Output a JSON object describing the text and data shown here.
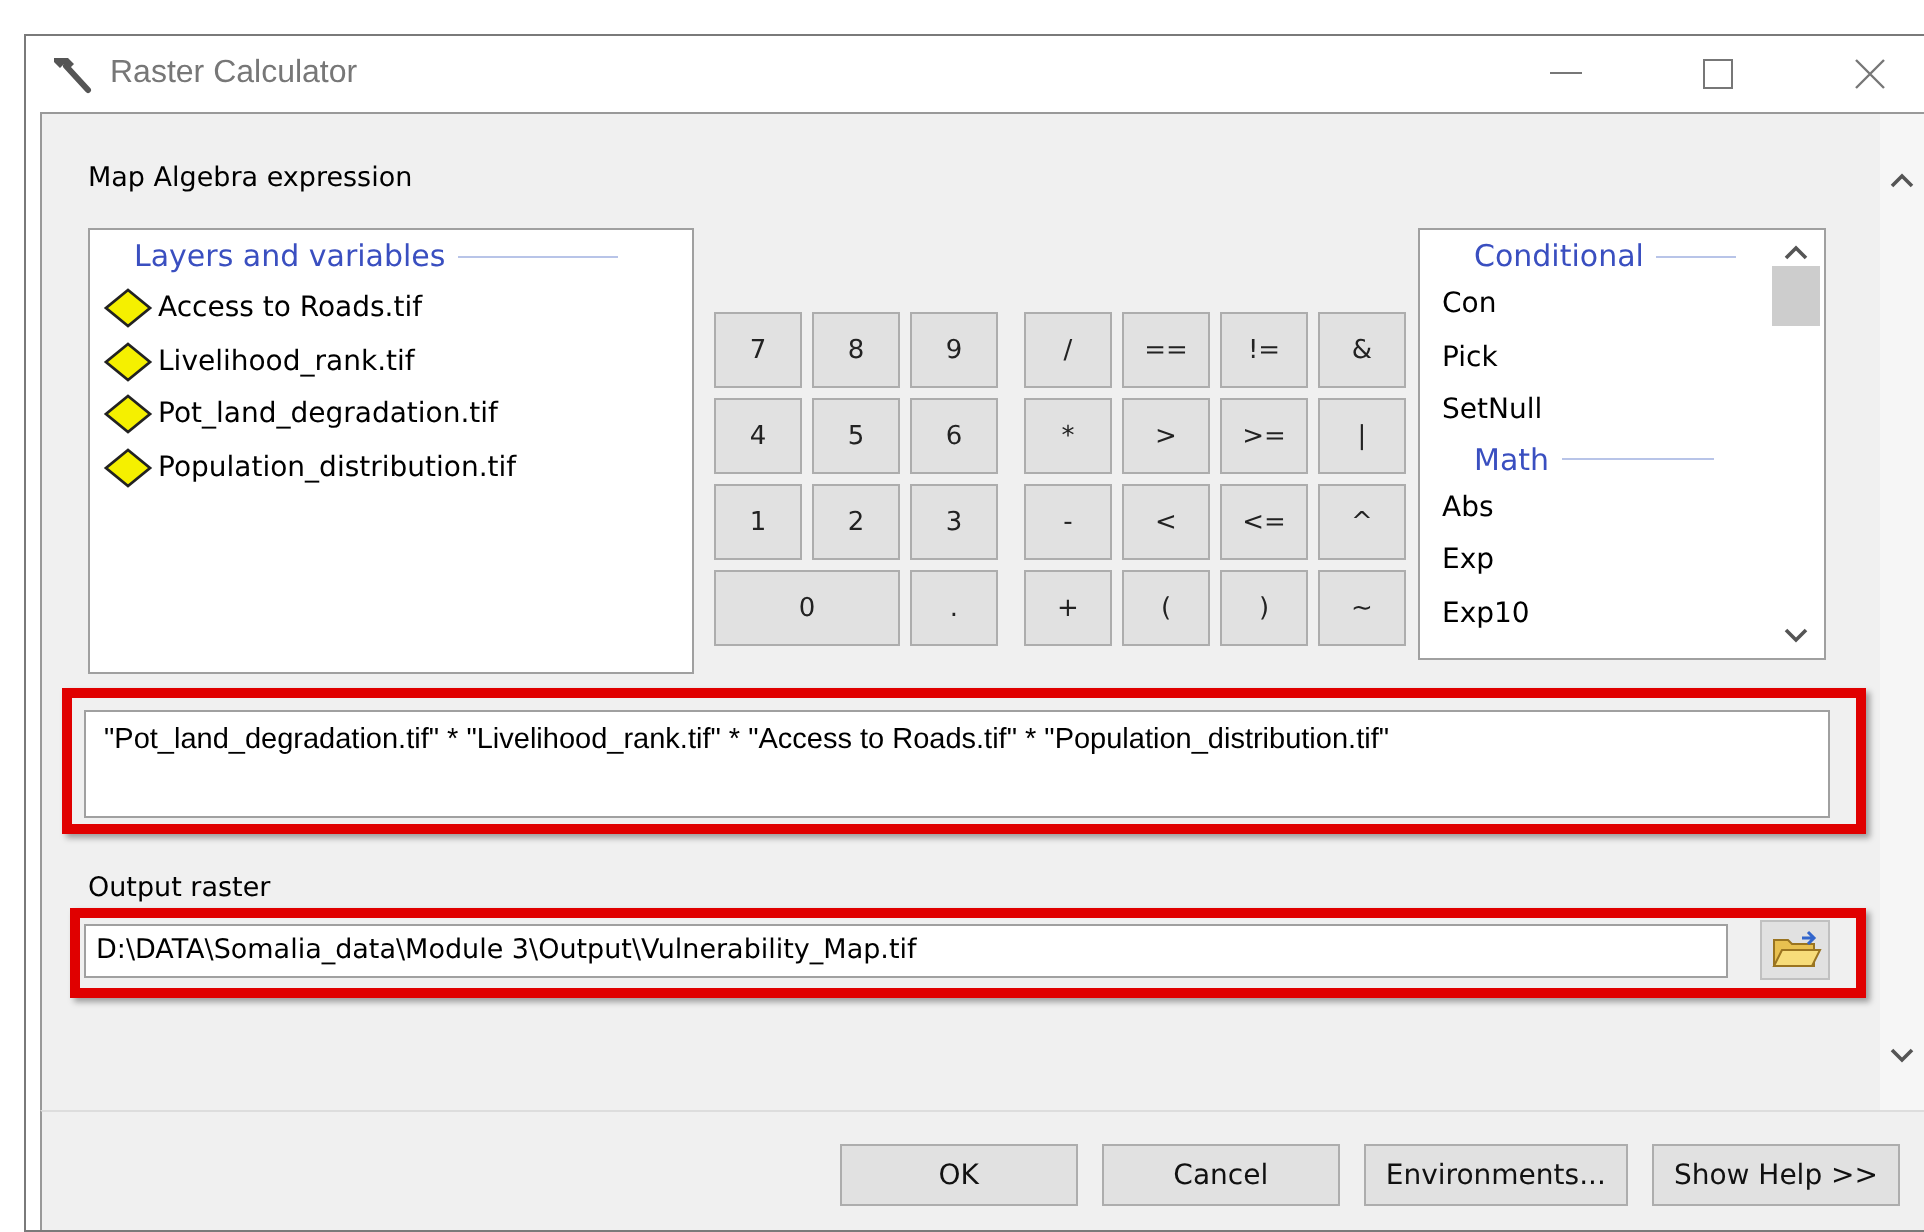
{
  "window": {
    "title": "Raster Calculator"
  },
  "expression_label": "Map Algebra expression",
  "layers": {
    "title": "Layers and variables",
    "items": [
      {
        "label": "Access to Roads.tif"
      },
      {
        "label": "Livelihood_rank.tif"
      },
      {
        "label": "Pot_land_degradation.tif"
      },
      {
        "label": "Population_distribution.tif"
      }
    ]
  },
  "keypad": {
    "digits": [
      {
        "label": "7",
        "kind": "normal"
      },
      {
        "label": "8",
        "kind": "normal"
      },
      {
        "label": "9",
        "kind": "normal"
      },
      {
        "label": "4",
        "kind": "normal"
      },
      {
        "label": "5",
        "kind": "normal"
      },
      {
        "label": "6",
        "kind": "normal"
      },
      {
        "label": "1",
        "kind": "normal"
      },
      {
        "label": "2",
        "kind": "normal"
      },
      {
        "label": "3",
        "kind": "normal"
      },
      {
        "label": "0",
        "kind": "wide"
      },
      {
        "label": ".",
        "kind": "normal"
      }
    ],
    "operators": [
      "/",
      "==",
      "!=",
      "&",
      "*",
      ">",
      ">=",
      "|",
      "-",
      "<",
      "<=",
      "^",
      "+",
      "(",
      ")",
      "~"
    ]
  },
  "functions": [
    {
      "kind": "header",
      "label": "Conditional"
    },
    {
      "kind": "function",
      "label": "Con"
    },
    {
      "kind": "function",
      "label": "Pick"
    },
    {
      "kind": "function",
      "label": "SetNull"
    },
    {
      "kind": "header",
      "label": "Math"
    },
    {
      "kind": "function",
      "label": "Abs"
    },
    {
      "kind": "function",
      "label": "Exp"
    },
    {
      "kind": "function",
      "label": "Exp10"
    }
  ],
  "expression": {
    "value": "\"Pot_land_degradation.tif\" * \"Livelihood_rank.tif\" * \"Access to Roads.tif\" * \"Population_distribution.tif\"",
    "highlighted": true
  },
  "output": {
    "label": "Output raster",
    "value": "D:\\DATA\\Somalia_data\\Module 3\\Output\\Vulnerability_Map.tif",
    "highlighted": true
  },
  "buttons": [
    "OK",
    "Cancel",
    "Environments...",
    "Show Help >>"
  ]
}
